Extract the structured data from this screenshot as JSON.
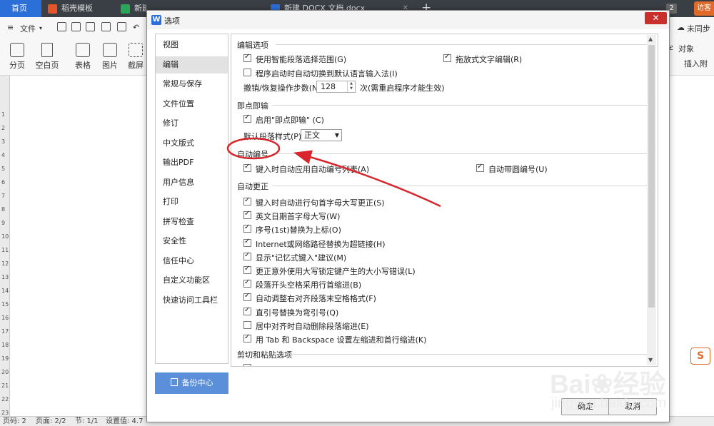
{
  "tabs": [
    {
      "label": "首页"
    },
    {
      "label": "稻壳模板"
    },
    {
      "label": "新建 XLS 工作表.xls"
    },
    {
      "label": "新建 DOCX 文档.docx"
    }
  ],
  "tab_count": "2",
  "visitor": "访客",
  "toolbar": {
    "file": "文件",
    "sync": "未同步"
  },
  "ribbon": {
    "items": [
      {
        "label": "分页"
      },
      {
        "label": "空白页"
      },
      {
        "label": "表格"
      },
      {
        "label": "图片"
      },
      {
        "label": "截屏"
      }
    ],
    "right_items": [
      {
        "label": "字"
      },
      {
        "label": "对象"
      },
      {
        "label": "插入附"
      }
    ]
  },
  "ruler_numbers": [
    "1",
    "2",
    "3",
    "4",
    "5",
    "6",
    "7",
    "8",
    "9",
    "10",
    "11",
    "12",
    "13",
    "14",
    "15",
    "16",
    "17",
    "18",
    "19",
    "20",
    "21",
    "22",
    "23"
  ],
  "status": {
    "page_no": "页码: 2",
    "page": "页面: 2/2",
    "section": "节: 1/1",
    "setting": "设置值: 4.7"
  },
  "dialog": {
    "title": "选项",
    "close": "✕",
    "nav": [
      {
        "label": "视图"
      },
      {
        "label": "编辑"
      },
      {
        "label": "常规与保存"
      },
      {
        "label": "文件位置"
      },
      {
        "label": "修订"
      },
      {
        "label": "中文版式"
      },
      {
        "label": "输出PDF"
      },
      {
        "label": "用户信息"
      },
      {
        "label": "打印"
      },
      {
        "label": "拼写检查"
      },
      {
        "label": "安全性"
      },
      {
        "label": "信任中心"
      },
      {
        "label": "自定义功能区"
      },
      {
        "label": "快速访问工具栏"
      }
    ],
    "selected_nav": "编辑",
    "backup": "备份中心",
    "ok": "确定",
    "cancel": "取消",
    "sections": {
      "edit": {
        "title": "编辑选项",
        "smart_select": "使用智能段落选择范围(G)",
        "drag_edit": "拖放式文字编辑(R)",
        "ime_switch": "程序启动时自动切换到默认语言输入法(I)",
        "undo_label": "撤销/恢复操作步数(N):",
        "undo_value": "128",
        "undo_note": "次(需重启程序才能生效)"
      },
      "click_type": {
        "title": "即点即输",
        "enable": "启用\"即点即输\" (C)",
        "style_label": "默认段落样式(P):",
        "style_value": "正文"
      },
      "auto_number": {
        "title": "自动编号",
        "auto_list": "键入时自动应用自动编号列表(A)",
        "circle_number": "自动带圆编号(U)"
      },
      "auto_correct": {
        "title": "自动更正",
        "items": [
          {
            "label": "键入时自动进行句首字母大写更正(S)",
            "checked": true
          },
          {
            "label": "英文日期首字母大写(W)",
            "checked": true
          },
          {
            "label": "序号(1st)替换为上标(O)",
            "checked": true
          },
          {
            "label": "Internet或网络路径替换为超链接(H)",
            "checked": true
          },
          {
            "label": "显示\"记忆式键入\"建议(M)",
            "checked": true
          },
          {
            "label": "更正意外使用大写锁定键产生的大小写错误(L)",
            "checked": true
          },
          {
            "label": "段落开头空格采用行首缩进(B)",
            "checked": true
          },
          {
            "label": "自动调整右对齐段落末空格格式(F)",
            "checked": true
          },
          {
            "label": "直引号替换为弯引号(Q)",
            "checked": true
          },
          {
            "label": "居中对齐时自动删除段落缩进(E)",
            "checked": false
          },
          {
            "label": "用 Tab 和 Backspace 设置左缩进和首行缩进(K)",
            "checked": true
          }
        ]
      },
      "cut_paste": {
        "title": "剪切和粘贴选项"
      }
    }
  },
  "watermark": {
    "brand": "Bai",
    "brand2": "经验",
    "url": "jingyan.baidu.com"
  },
  "colors": {
    "accent": "#2d6fd8",
    "annotation": "#d9262c",
    "close": "#c9302c"
  }
}
